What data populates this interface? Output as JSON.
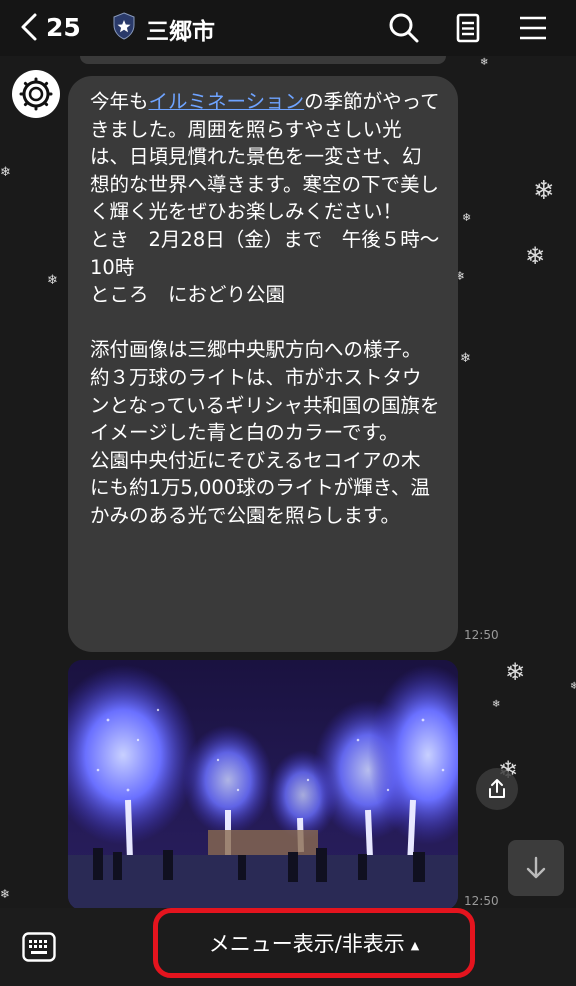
{
  "header": {
    "back_count": "25",
    "title": "三郷市",
    "icons": [
      "chevron-left-icon",
      "shield-icon",
      "search-icon",
      "notes-icon",
      "menu-icon"
    ]
  },
  "message": {
    "before_link": "今年も",
    "link_text": "イルミネーション",
    "after_link": "の季節がやってきました。周囲を照らすやさしい光は、日頃見慣れた景色を一変させ、幻想的な世界へ導きます。寒空の下で美しく輝く光をぜひお楽しみください！\nとき　2月28日（金）まで　午後５時～10時\nところ　におどり公園\n\n添付画像は三郷中央駅方向への様子。\n約３万球のライトは、市がホストタウンとなっているギリシャ共和国の国旗をイメージした青と白のカラーです。\n公園中央付近にそびえるセコイアの木にも約1万5,000球のライトが輝き、温かみのある光で公園を照らします。",
    "time": "12:50"
  },
  "photo": {
    "time": "12:50",
    "icons": [
      "share-icon"
    ]
  },
  "scroll_down_icon": "arrow-down-icon",
  "bottom": {
    "keyboard_icon": "keyboard-icon",
    "menu_label": "メニュー表示/非表示",
    "menu_arrow": "▲"
  },
  "colors": {
    "background": "#1a1a1a",
    "bubble": "#3a3a3a",
    "link": "#6ea3ff",
    "highlight": "#e4141e"
  }
}
